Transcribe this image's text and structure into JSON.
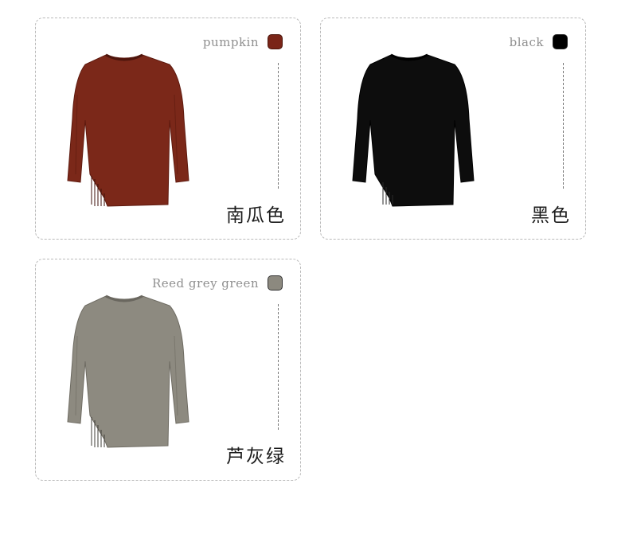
{
  "swatches": [
    {
      "english": "pumpkin",
      "chinese": "南瓜色",
      "color": "#7a2518",
      "knit": "#6a1f12"
    },
    {
      "english": "black",
      "chinese": "黑色",
      "color": "#000000",
      "knit": "#101010"
    },
    {
      "english": "Reed grey green",
      "chinese": "芦灰绿",
      "color": "#8c897f",
      "knit": "#8a877d"
    }
  ]
}
